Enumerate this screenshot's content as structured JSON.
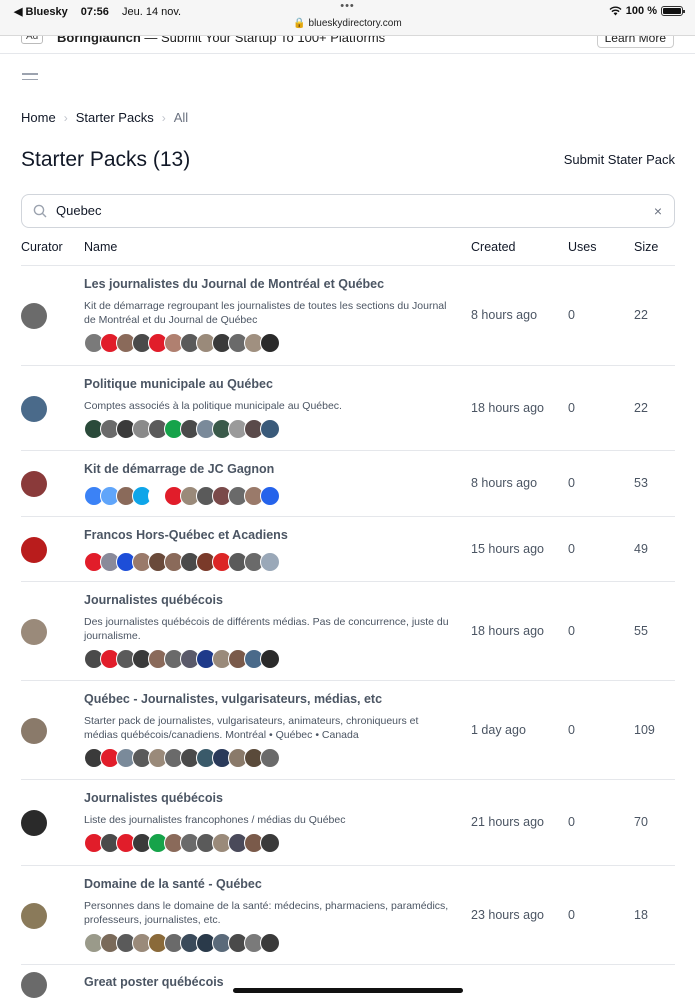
{
  "status_bar": {
    "back_app": "◀ Bluesky",
    "time": "07:56",
    "date": "Jeu. 14 nov.",
    "dots": "•••",
    "url": "🔒 blueskydirectory.com",
    "wifi": "wifi-icon",
    "battery": "100 %",
    "battery_level": 1.0
  },
  "ad": {
    "badge": "Ad",
    "brand": "Boringlaunch",
    "text": " — Submit Your Startup To 100+ Platforms",
    "button": "Learn More"
  },
  "breadcrumb": [
    "Home",
    "Starter Packs",
    "All"
  ],
  "page_title": "Starter Packs (13)",
  "submit_label": "Submit Stater Pack",
  "search": {
    "value": "Quebec",
    "icon": "search-icon",
    "clear": "×"
  },
  "columns": {
    "curator": "Curator",
    "name": "Name",
    "created": "Created",
    "uses": "Uses",
    "size": "Size"
  },
  "rows": [
    {
      "name": "Les journalistes du Journal de Montréal et Québec",
      "description": "Kit de démarrage regroupant les journalistes de toutes les sections du Journal de Montréal et du Journal de Québec",
      "created": "8 hours ago",
      "uses": "0",
      "size": "22",
      "avatar_color": "#6b6b6b",
      "members": [
        "#7a7a7a",
        "#e11d2a",
        "#8a6a5a",
        "#4a4a4a",
        "#e11d2a",
        "#b08070",
        "#5a5a5a",
        "#9a8a7a",
        "#3a3a3a",
        "#6a6a6a",
        "#a09080",
        "#2a2a2a"
      ]
    },
    {
      "name": "Politique municipale au Québec",
      "description": "Comptes associés à la politique municipale au Québec.",
      "created": "18 hours ago",
      "uses": "0",
      "size": "22",
      "avatar_color": "#4a6a8a",
      "members": [
        "#2a4a3a",
        "#6a6a6a",
        "#3a3a3a",
        "#8a8a8a",
        "#5a5a5a",
        "#16a34a",
        "#4a4a4a",
        "#7a8a9a",
        "#3a5a4a",
        "#9a9a9a",
        "#5a4a4a",
        "#3a5a7a"
      ]
    },
    {
      "name": "Kit de démarrage de JC Gagnon",
      "description": "",
      "created": "8 hours ago",
      "uses": "0",
      "size": "53",
      "avatar_color": "#8a3a3a",
      "members": [
        "#3b82f6",
        "#60a5fa",
        "#8a6a5a",
        "#0ea5e9",
        "#ffffff",
        "#e11d2a",
        "#9a8a7a",
        "#5a5a5a",
        "#7a4a4a",
        "#6a6a6a",
        "#9a7a6a",
        "#2563eb"
      ]
    },
    {
      "name": "Francos Hors-Québec et Acadiens",
      "description": "",
      "created": "15 hours ago",
      "uses": "0",
      "size": "49",
      "avatar_color": "#b91c1c",
      "members": [
        "#e11d2a",
        "#8a8a9a",
        "#1d4ed8",
        "#9a7a6a",
        "#6a4a3a",
        "#8a6a5a",
        "#4a4a4a",
        "#7a3a2a",
        "#dc2626",
        "#5a5a5a",
        "#6a6a6a",
        "#9aa8b8"
      ]
    },
    {
      "name": "Journalistes québécois",
      "description": "Des journalistes québécois de différents médias. Pas de concurrence, juste du journalisme.",
      "created": "18 hours ago",
      "uses": "0",
      "size": "55",
      "avatar_color": "#9a8a7a",
      "members": [
        "#4a4a4a",
        "#e11d2a",
        "#5a5a5a",
        "#3a3a3a",
        "#8a6a5a",
        "#6a6a6a",
        "#5a5a6a",
        "#1e3a8a",
        "#9a8a7a",
        "#7a5a4a",
        "#4a6a8a",
        "#2a2a2a"
      ]
    },
    {
      "name": "Québec - Journalistes, vulgarisateurs, médias, etc",
      "description": "Starter pack de journalistes, vulgarisateurs, animateurs, chroniqueurs et médias québécois/canadiens. Montréal • Québec • Canada",
      "created": "1 day ago",
      "uses": "0",
      "size": "109",
      "avatar_color": "#8a7a6a",
      "members": [
        "#3a3a3a",
        "#e11d2a",
        "#7a8a9a",
        "#5a5a5a",
        "#9a8a7a",
        "#6a6a6a",
        "#4a4a4a",
        "#3a5a6a",
        "#2a3a5a",
        "#8a7a6a",
        "#5a4a3a",
        "#6a6a6a"
      ]
    },
    {
      "name": "Journalistes québécois",
      "description": "Liste des journalistes francophones / médias du Québec",
      "created": "21 hours ago",
      "uses": "0",
      "size": "70",
      "avatar_color": "#2a2a2a",
      "members": [
        "#e11d2a",
        "#4a4a4a",
        "#e11d2a",
        "#3a3a3a",
        "#16a34a",
        "#8a6a5a",
        "#6a6a6a",
        "#5a5a5a",
        "#9a8a7a",
        "#4a4a5a",
        "#7a5a4a",
        "#3a3a3a"
      ]
    },
    {
      "name": "Domaine de la santé - Québec",
      "description": "Personnes dans le domaine de la santé: médecins, pharmaciens, paramédics, professeurs, journalistes, etc.",
      "created": "23 hours ago",
      "uses": "0",
      "size": "18",
      "avatar_color": "#8a7a5a",
      "members": [
        "#9a9a8a",
        "#7a6a5a",
        "#5a5a5a",
        "#9a8a7a",
        "#8a6a3a",
        "#6a6a6a",
        "#3a4a5a",
        "#2a3a4a",
        "#5a6a7a",
        "#4a4a4a",
        "#7a7a7a",
        "#3a3a3a"
      ]
    },
    {
      "name": "Great poster québécois",
      "description": "",
      "created": "",
      "uses": "",
      "size": "",
      "avatar_color": "#6a6a6a",
      "members": []
    }
  ]
}
